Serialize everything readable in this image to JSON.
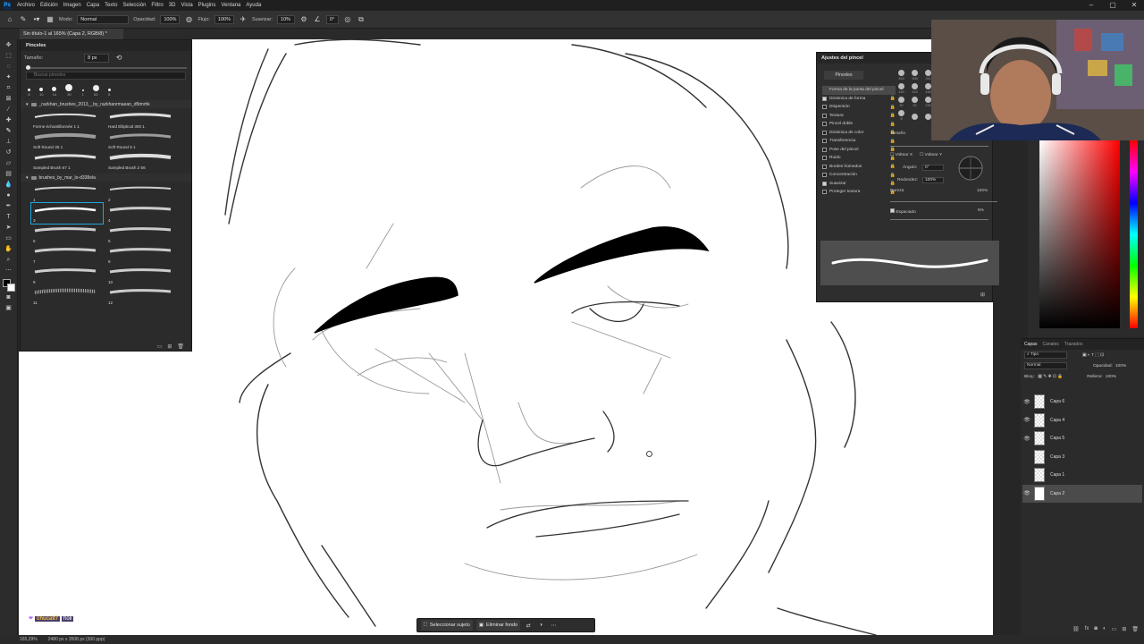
{
  "menu": {
    "logo": "Ps",
    "items": [
      "Archivo",
      "Edición",
      "Imagen",
      "Capa",
      "Texto",
      "Selección",
      "Filtro",
      "3D",
      "Vista",
      "Plugins",
      "Ventana",
      "Ayuda"
    ]
  },
  "options_bar": {
    "mode_label": "Modo:",
    "mode_value": "Normal",
    "opacity_label": "Opacidad:",
    "opacity_value": "100%",
    "flow_label": "Flujo:",
    "flow_value": "100%",
    "smoothing_label": "Suavizar:",
    "smoothing_value": "10%",
    "angle_value": "0°"
  },
  "document_tab": "Sin título-1 al 165% (Capa 2, RGB/8) *",
  "brushes_panel": {
    "title": "Pinceles",
    "size_label": "Tamaño:",
    "size_value": "8 px",
    "search_placeholder": "Buscar pinceles",
    "tips": [
      "8",
      "10",
      "14",
      "30",
      "1",
      "63",
      "8"
    ],
    "group1": "_razkhan_brushes_2013__by_razkhanrmaean_d5tmrhk",
    "group1_brushes": [
      "Forme échantillonnée 1 1",
      "Hard Elliptical 300 1",
      "Soft Round 35 1",
      "Soft Round 9 1",
      "Sampled Brush 67 1",
      "Sampled Brush 2 56"
    ],
    "group2": "brushes_by_mar_lo-d338ela",
    "group2_brushes": [
      "1",
      "2",
      "3",
      "4",
      "5",
      "6",
      "7",
      "8",
      "9",
      "10",
      "11",
      "12"
    ]
  },
  "brush_settings": {
    "title": "Ajustes del pincel",
    "tab": "Pinceles",
    "options": [
      {
        "label": "Forma de la punta del pincel",
        "checked": null,
        "active": true
      },
      {
        "label": "Dinámica de forma",
        "checked": true
      },
      {
        "label": "Dispersión",
        "checked": false
      },
      {
        "label": "Textura",
        "checked": false
      },
      {
        "label": "Pincel doble",
        "checked": false
      },
      {
        "label": "Dinámica de color",
        "checked": false
      },
      {
        "label": "Transferencia",
        "checked": false
      },
      {
        "label": "Pose del pincel",
        "checked": false
      },
      {
        "label": "Ruido",
        "checked": false
      },
      {
        "label": "Bordes húmedos",
        "checked": false
      },
      {
        "label": "Concentración",
        "checked": false
      },
      {
        "label": "Suavizar",
        "checked": true
      },
      {
        "label": "Proteger textura",
        "checked": false
      }
    ],
    "tip_sizes": [
      "443",
      "308",
      "311",
      "1",
      "449",
      "443",
      "448",
      "408",
      "30",
      "30",
      "239",
      "1",
      "8",
      "",
      "",
      ""
    ],
    "size_label": "Tamaño",
    "flip_x": "Voltear X",
    "flip_y": "Voltear Y",
    "angle_label": "Ángulo:",
    "angle_value": "0°",
    "roundness_label": "Redondez:",
    "roundness_value": "100%",
    "hardness_label": "Dureza",
    "hardness_value": "100%",
    "spacing_label": "Espaciado",
    "spacing_value": "5%"
  },
  "layers_panel": {
    "tabs": [
      "Capas",
      "Canales",
      "Trazados"
    ],
    "filter": "Tipo",
    "blend": "Normal",
    "opacity_label": "Opacidad:",
    "opacity_value": "100%",
    "lock_label": "Bloq.:",
    "fill_label": "Relleno:",
    "fill_value": "100%",
    "layers": [
      {
        "name": "Capa 6",
        "visible": true,
        "selected": false
      },
      {
        "name": "Capa 4",
        "visible": true,
        "selected": false
      },
      {
        "name": "Capa 5",
        "visible": true,
        "selected": false
      },
      {
        "name": "Capa 3",
        "visible": false,
        "selected": false
      },
      {
        "name": "Capa 1",
        "visible": false,
        "selected": false
      },
      {
        "name": "Capa 2",
        "visible": true,
        "selected": true
      }
    ]
  },
  "context_bar": {
    "select_subject": "Seleccionar sujeto",
    "remove_bg": "Eliminar fondo"
  },
  "status": {
    "zoom": "165,29%",
    "doc_size": "2480 px x 3508 px (300 ppp)"
  },
  "chat": {
    "user": "chuca97",
    "message": "holi"
  },
  "colors": {
    "accent": "#1fa6e0",
    "foreground": "#000000",
    "background": "#ffffff"
  }
}
